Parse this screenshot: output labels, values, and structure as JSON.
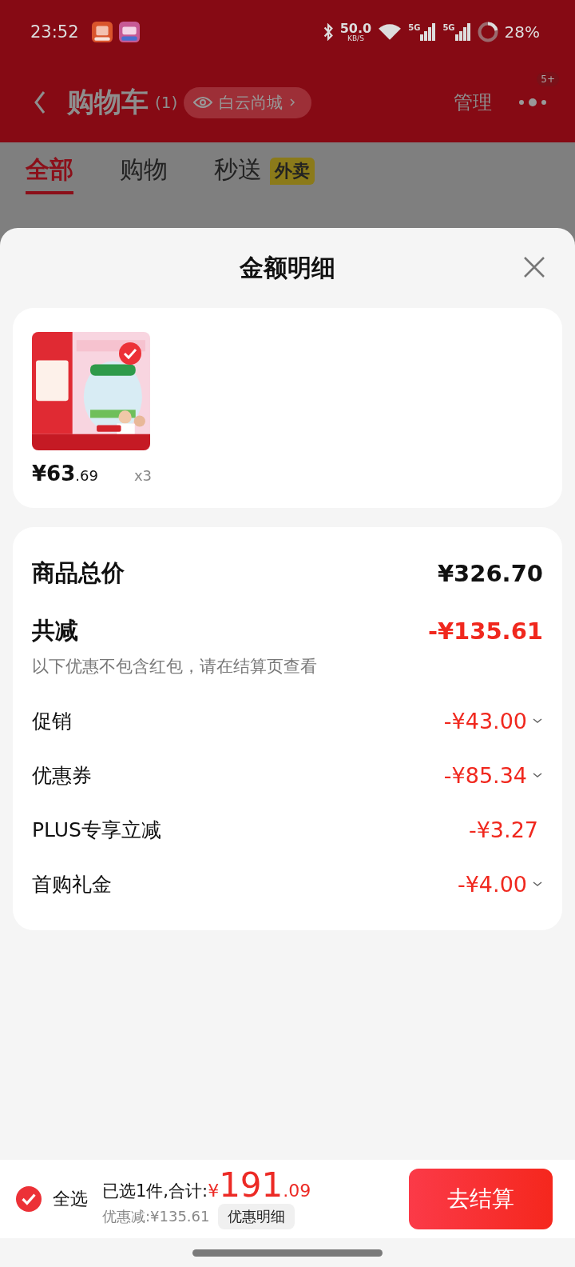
{
  "status_bar": {
    "time": "23:52",
    "net_speed": "50.0",
    "net_unit": "KB/S",
    "signals": [
      "5G",
      "5G"
    ],
    "battery": "28%"
  },
  "header": {
    "title": "购物车",
    "count": "(1)",
    "store": "白云尚城",
    "manage": "管理",
    "badge": "5+"
  },
  "tabs": [
    {
      "label": "全部",
      "selected": true
    },
    {
      "label": "购物",
      "selected": false
    },
    {
      "label": "秒送",
      "selected": false,
      "tag": "外卖"
    }
  ],
  "sheet": {
    "title": "金额明细",
    "items": [
      {
        "checked": true,
        "price": "¥63",
        "price_decimal": ".69",
        "quantity": "x3"
      }
    ],
    "summary": [
      {
        "kind": "total",
        "label": "商品总价",
        "amount": "¥326.70"
      },
      {
        "kind": "reduction",
        "label": "共减",
        "amount": "-¥135.61"
      },
      {
        "kind": "note",
        "label": "以下优惠不包含红包，请在结算页查看"
      },
      {
        "kind": "line",
        "label": "促销",
        "amount": "-¥43.00",
        "expandable": true
      },
      {
        "kind": "line",
        "label": "优惠券",
        "amount": "-¥85.34",
        "expandable": true
      },
      {
        "kind": "line",
        "label": "PLUS专享立减",
        "amount": "-¥3.27",
        "expandable": false
      },
      {
        "kind": "line",
        "label": "首购礼金",
        "amount": "-¥4.00",
        "expandable": true
      }
    ]
  },
  "footer": {
    "select_all": {
      "label": "全选",
      "checked": true
    },
    "selected_text": "已选1件,合计:",
    "currency": "¥",
    "total": "191",
    "total_decimal": ".09",
    "saving": "优惠减:¥135.61",
    "detail_button": "优惠明细",
    "checkout": "去结算"
  }
}
